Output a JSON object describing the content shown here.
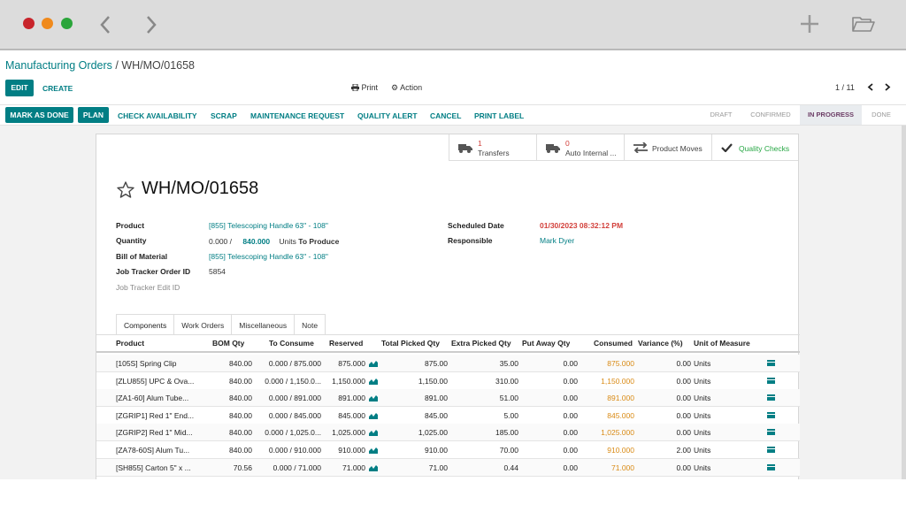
{
  "breadcrumb": {
    "parent": "Manufacturing Orders",
    "sep": "/",
    "current": "WH/MO/01658"
  },
  "toolbar": {
    "edit": "EDIT",
    "create": "CREATE",
    "print": "Print",
    "action": "Action",
    "pager": "1 / 11"
  },
  "actions": {
    "mark_done": "MARK AS DONE",
    "plan": "PLAN",
    "check_availability": "CHECK AVAILABILITY",
    "scrap": "SCRAP",
    "maintenance": "MAINTENANCE REQUEST",
    "quality_alert": "QUALITY ALERT",
    "cancel": "CANCEL",
    "print_label": "PRINT LABEL"
  },
  "stages": [
    "DRAFT",
    "CONFIRMED",
    "IN PROGRESS",
    "DONE"
  ],
  "active_stage": "IN PROGRESS",
  "smart_buttons": {
    "transfers_count": "1",
    "transfers_label": "Transfers",
    "auto_count": "0",
    "auto_label": "Auto Internal ...",
    "moves_label": "Product Moves",
    "quality_label": "Quality Checks"
  },
  "record": {
    "title": "WH/MO/01658",
    "product_label": "Product",
    "product": "[855] Telescoping Handle 63\" - 108\"",
    "quantity_label": "Quantity",
    "qty_done": "0.000",
    "qty_sep": "/",
    "qty_total": "840.000",
    "qty_unit": "Units",
    "qty_to_produce": "To Produce",
    "bom_label": "Bill of Material",
    "bom": "[855] Telescoping Handle 63\" - 108\"",
    "job_tracker_label": "Job Tracker Order ID",
    "job_tracker": "5854",
    "job_tracker_edit_label": "Job Tracker Edit ID",
    "scheduled_label": "Scheduled Date",
    "scheduled": "01/30/2023 08:32:12 PM",
    "responsible_label": "Responsible",
    "responsible": "Mark Dyer"
  },
  "tabs": [
    "Components",
    "Work Orders",
    "Miscellaneous",
    "Note"
  ],
  "table": {
    "headers": [
      "Product",
      "BOM Qty",
      "To Consume",
      "Reserved",
      "Total Picked Qty",
      "Extra Picked Qty",
      "Put Away Qty",
      "Consumed",
      "Variance (%)",
      "Unit of Measure"
    ],
    "rows": [
      [
        "[105S] Spring Clip",
        "840.00",
        "0.000 / 875.000",
        "875.000",
        "875.00",
        "35.00",
        "0.00",
        "875.000",
        "0.00",
        "Units"
      ],
      [
        "[ZLU855] UPC & Ova...",
        "840.00",
        "0.000 / 1,150.0...",
        "1,150.000",
        "1,150.00",
        "310.00",
        "0.00",
        "1,150.000",
        "0.00",
        "Units"
      ],
      [
        "[ZA1-60] Alum Tube...",
        "840.00",
        "0.000 / 891.000",
        "891.000",
        "891.00",
        "51.00",
        "0.00",
        "891.000",
        "0.00",
        "Units"
      ],
      [
        "[ZGRIP1] Red 1\" End...",
        "840.00",
        "0.000 / 845.000",
        "845.000",
        "845.00",
        "5.00",
        "0.00",
        "845.000",
        "0.00",
        "Units"
      ],
      [
        "[ZGRIP2] Red 1\" Mid...",
        "840.00",
        "0.000 / 1,025.0...",
        "1,025.000",
        "1,025.00",
        "185.00",
        "0.00",
        "1,025.000",
        "0.00",
        "Units"
      ],
      [
        "[ZA78-60S] Alum Tu...",
        "840.00",
        "0.000 / 910.000",
        "910.000",
        "910.00",
        "70.00",
        "0.00",
        "910.000",
        "2.00",
        "Units"
      ],
      [
        "[SH855] Carton 5\" x ...",
        "70.56",
        "0.000 / 71.000",
        "71.000",
        "71.00",
        "0.44",
        "0.00",
        "71.000",
        "0.00",
        "Units"
      ]
    ]
  },
  "colors": {
    "accent": "#017e84",
    "active_stage": "#6c3d66",
    "date_red": "#d23f3a",
    "consumed_orange": "#d98a14"
  }
}
